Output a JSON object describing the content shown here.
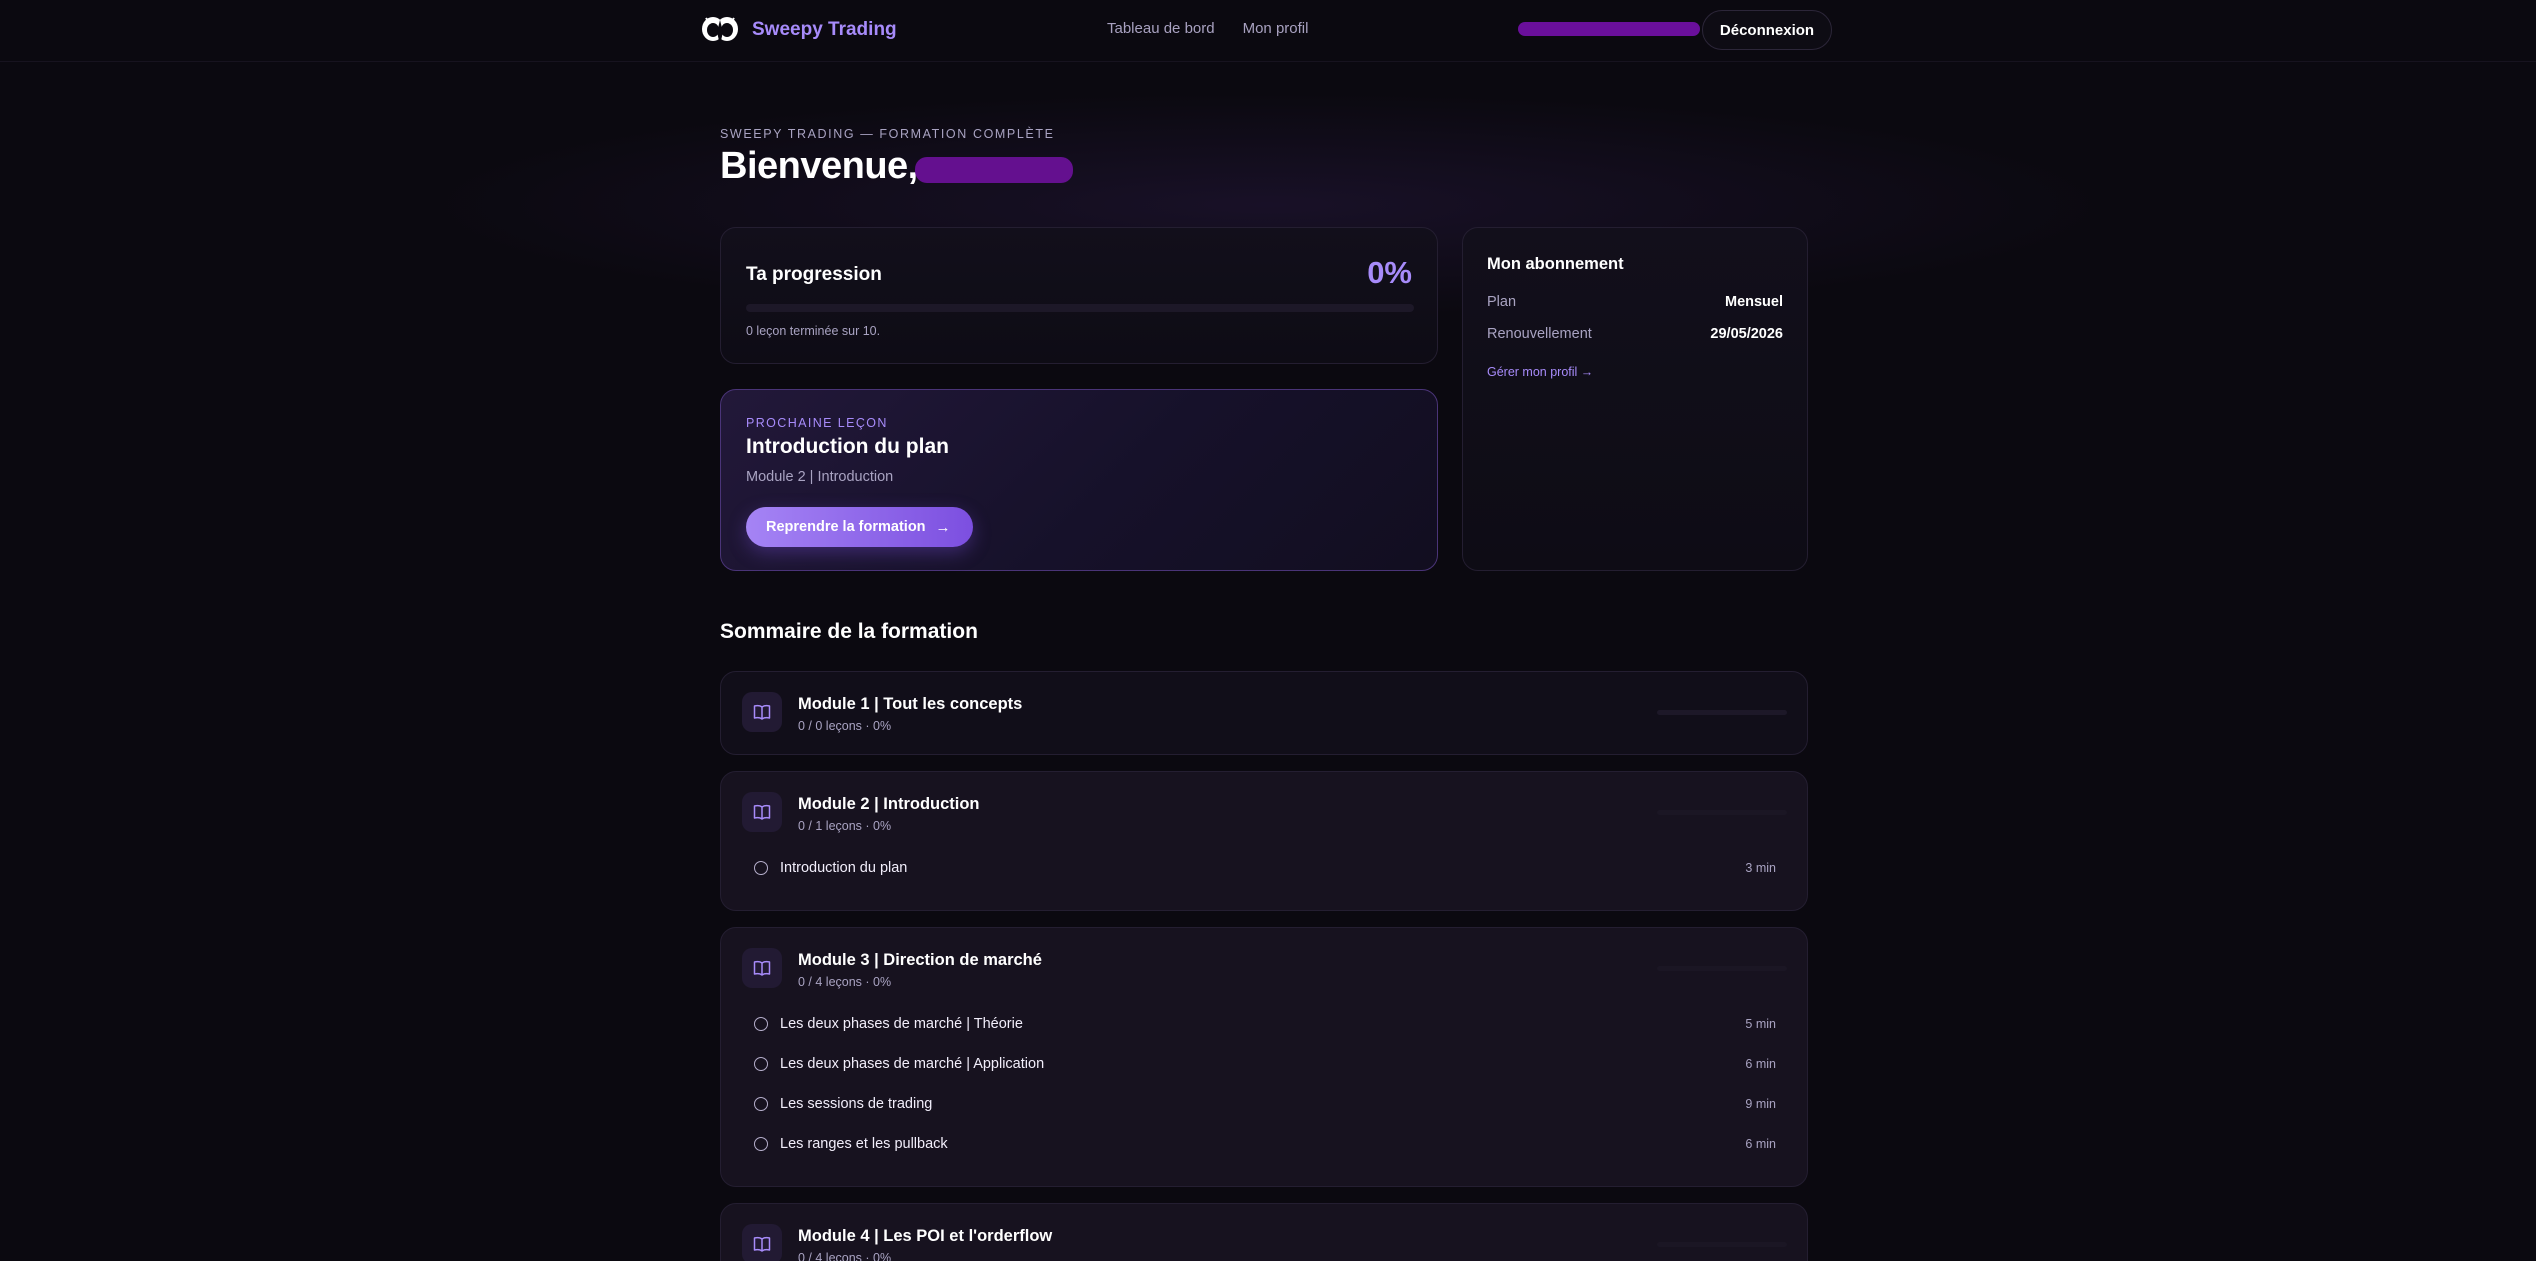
{
  "nav": {
    "brand": "Sweepy Trading",
    "links": [
      "Tableau de bord",
      "Mon profil"
    ],
    "logout": "Déconnexion"
  },
  "header": {
    "eyebrow": "SWEEPY TRADING — FORMATION COMPLÈTE",
    "welcome": "Bienvenue,"
  },
  "progress": {
    "title": "Ta progression",
    "percent_label": "0%",
    "percent": 0,
    "caption": "0 leçon terminée sur 10."
  },
  "next_lesson": {
    "eyebrow": "PROCHAINE LEÇON",
    "title": "Introduction du plan",
    "module": "Module 2 | Introduction",
    "button": "Reprendre la formation"
  },
  "subscription": {
    "title": "Mon abonnement",
    "plan_label": "Plan",
    "plan_value": "Mensuel",
    "renewal_label": "Renouvellement",
    "renewal_value": "29/05/2026",
    "manage_link": "Gérer mon profil →"
  },
  "summary": {
    "title": "Sommaire de la formation",
    "modules": [
      {
        "title": "Module 1 | Tout les concepts",
        "meta": "0 / 0 leçons · 0%",
        "lessons": []
      },
      {
        "title": "Module 2 | Introduction",
        "meta": "0 / 1 leçons · 0%",
        "lessons": [
          {
            "title": "Introduction du plan",
            "duration": "3 min"
          }
        ]
      },
      {
        "title": "Module 3 | Direction de marché",
        "meta": "0 / 4 leçons · 0%",
        "lessons": [
          {
            "title": "Les deux phases de marché | Théorie",
            "duration": "5 min"
          },
          {
            "title": "Les deux phases de marché | Application",
            "duration": "6 min"
          },
          {
            "title": "Les sessions de trading",
            "duration": "9 min"
          },
          {
            "title": "Les ranges et les pullback",
            "duration": "6 min"
          }
        ]
      },
      {
        "title": "Module 4 | Les POI et l'orderflow",
        "meta": "0 / 4 leçons · 0%",
        "lessons": []
      }
    ]
  },
  "colors": {
    "accent": "#a78bfa",
    "background": "#0b0910",
    "redaction": "#6a0f9b"
  },
  "icons": [
    "sweepy-logo-icon",
    "book-icon",
    "arrow-right-icon",
    "lesson-circle-icon"
  ]
}
